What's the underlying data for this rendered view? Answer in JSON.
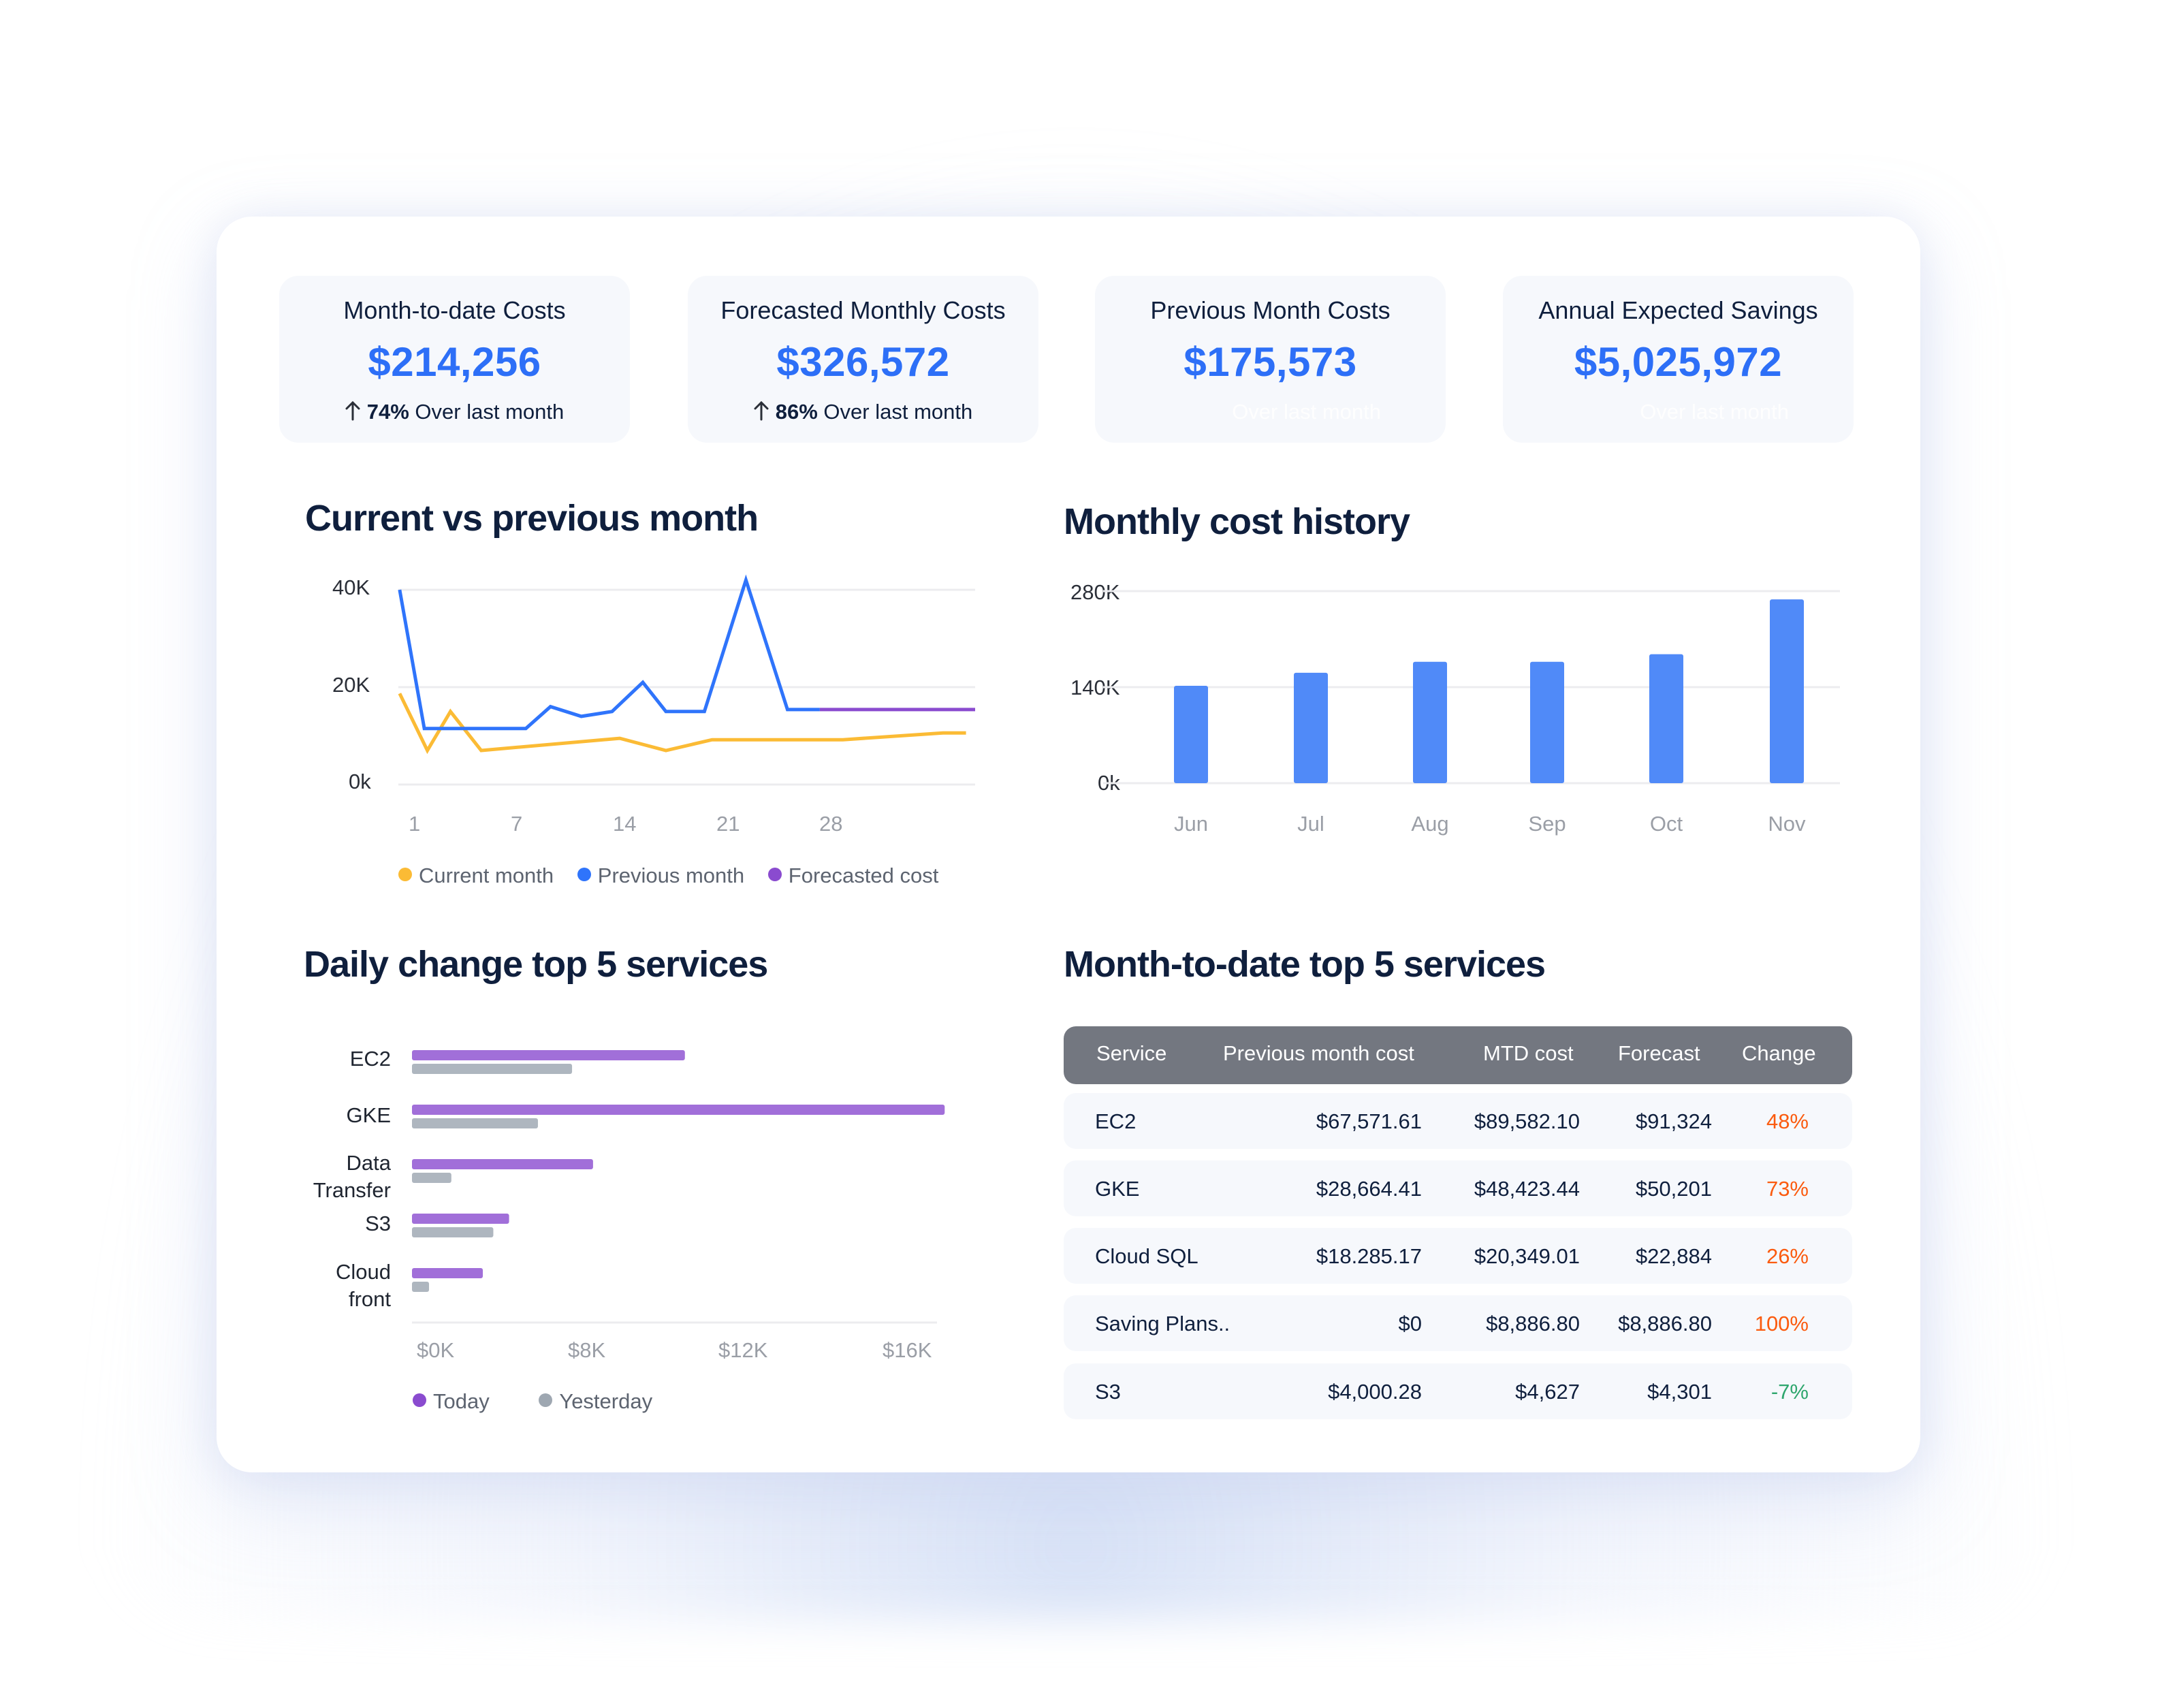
{
  "kpis": [
    {
      "title": "Month-to-date Costs",
      "value": "$214,256",
      "change_pct": "74%",
      "change_text": "Over last month",
      "arrow": "arrow-up-icon"
    },
    {
      "title": "Forecasted Monthly Costs",
      "value": "$326,572",
      "change_pct": "86%",
      "change_text": "Over last month",
      "arrow": "arrow-up-icon"
    },
    {
      "title": "Previous Month Costs",
      "value": "$175,573",
      "ghost_text": "Over last month"
    },
    {
      "title": "Annual Expected Savings",
      "value": "$5,025,972",
      "ghost_text": "Over last month"
    }
  ],
  "colors": {
    "accent": "#2d6ff7",
    "current_month": "#fbbb35",
    "previous_month": "#2f74fb",
    "forecasted": "#8a4bcf",
    "history_bar": "#508af8",
    "today_bar": "#a16fd9",
    "yesterday_bar": "#aeb6bf",
    "change_up": "#fb5b0f",
    "change_down": "#2ea66d",
    "table_header": "#737780"
  },
  "chart_data": [
    {
      "type": "line",
      "title": "Current vs previous month",
      "xlabel": "",
      "ylabel": "",
      "x_ticks": [
        "1",
        "7",
        "14",
        "21",
        "28"
      ],
      "y_ticks": [
        "0k",
        "20K",
        "40K"
      ],
      "ylim": [
        0,
        40000
      ],
      "xlim": [
        1,
        31
      ],
      "grid": true,
      "legend": [
        {
          "label": "Current month",
          "color": "#fbbb35"
        },
        {
          "label": "Previous month",
          "color": "#2f74fb"
        },
        {
          "label": "Forecasted cost",
          "color": "#8a4bcf"
        }
      ],
      "legend_position": "bottom",
      "series": [
        {
          "name": "Current month",
          "x": [
            0.2,
            2,
            3.5,
            5.5,
            14.5,
            17.5,
            20.5,
            29,
            35.5,
            37
          ],
          "y": [
            18700,
            7000,
            15000,
            7000,
            9500,
            7000,
            9200,
            9200,
            10600,
            10600
          ]
        },
        {
          "name": "Previous month",
          "x": [
            0.2,
            1.8,
            8.4,
            10,
            12,
            14,
            16,
            17.5,
            20,
            22.7,
            25.4,
            27.5
          ],
          "y": [
            40000,
            11500,
            11500,
            16000,
            14000,
            15000,
            21000,
            15000,
            15000,
            42000,
            15400,
            15400
          ]
        },
        {
          "name": "Forecasted cost",
          "x": [
            27.5,
            44
          ],
          "y": [
            15400,
            15400
          ]
        }
      ]
    },
    {
      "type": "bar",
      "title": "Monthly cost history",
      "categories": [
        "Jun",
        "Jul",
        "Aug",
        "Sep",
        "Oct",
        "Nov"
      ],
      "values": [
        142000,
        161000,
        177000,
        177000,
        188000,
        268000
      ],
      "y_ticks": [
        "0k",
        "140K",
        "280K"
      ],
      "ylim": [
        0,
        280000
      ],
      "xlabel": "",
      "ylabel": "",
      "grid": true
    },
    {
      "type": "bar",
      "orientation": "horizontal",
      "title": "Daily change top 5 services",
      "categories": [
        "EC2",
        "GKE",
        "Data Transfer",
        "S3",
        "Cloud front"
      ],
      "category_lines": [
        [
          "EC2"
        ],
        [
          "GKE"
        ],
        [
          "Data",
          "Transfer"
        ],
        [
          "S3"
        ],
        [
          "Cloud",
          "front"
        ]
      ],
      "series": [
        {
          "name": "Today",
          "values": [
            10400,
            20300,
            6900,
            3700,
            2700
          ]
        },
        {
          "name": "Yesterday",
          "values": [
            6100,
            4800,
            1500,
            3100,
            650
          ]
        }
      ],
      "x_ticks": [
        "$0K",
        "$8K",
        "$12K",
        "$16K"
      ],
      "xlim": [
        0,
        20500
      ],
      "legend": [
        {
          "label": "Today",
          "color": "#8a4bcf"
        },
        {
          "label": "Yesterday",
          "color": "#9ea7b1"
        }
      ],
      "legend_position": "bottom-left",
      "grid": false
    }
  ],
  "sections": {
    "line_title": "Current vs previous month",
    "bar_title": "Monthly cost history",
    "hbar_title": "Daily change top 5 services",
    "table_title": "Month-to-date top 5 services"
  },
  "table": {
    "columns": [
      "Service",
      "Previous month cost",
      "MTD cost",
      "Forecast",
      "Change"
    ],
    "rows": [
      {
        "service": "EC2",
        "prev": "$67,571.61",
        "mtd": "$89,582.10",
        "forecast": "$91,324",
        "change": "48%",
        "direction": "up"
      },
      {
        "service": "GKE",
        "prev": "$28,664.41",
        "mtd": "$48,423.44",
        "forecast": "$50,201",
        "change": "73%",
        "direction": "up"
      },
      {
        "service": "Cloud SQL",
        "prev": "$18.285.17",
        "mtd": "$20,349.01",
        "forecast": "$22,884",
        "change": "26%",
        "direction": "up"
      },
      {
        "service": "Saving Plans..",
        "prev": "$0",
        "mtd": "$8,886.80",
        "forecast": "$8,886.80",
        "change": "100%",
        "direction": "up"
      },
      {
        "service": "S3",
        "prev": "$4,000.28",
        "mtd": "$4,627",
        "forecast": "$4,301",
        "change": "-7%",
        "direction": "down"
      }
    ]
  }
}
